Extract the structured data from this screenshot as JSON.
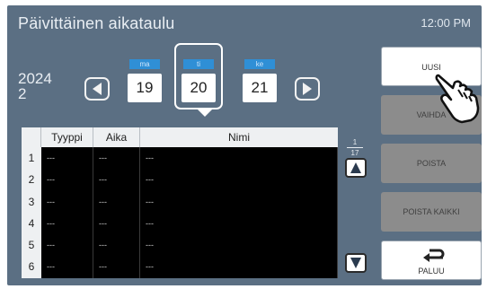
{
  "header": {
    "title": "Päivittäinen aikataulu",
    "time": "12:00 PM"
  },
  "date_nav": {
    "year": "2024",
    "month": "2",
    "days": [
      {
        "dow": "ma",
        "num": "19",
        "selected": false
      },
      {
        "dow": "ti",
        "num": "20",
        "selected": true
      },
      {
        "dow": "ke",
        "num": "21",
        "selected": false
      }
    ]
  },
  "table": {
    "headers": [
      "Tyyppi",
      "Aika",
      "Nimi"
    ],
    "row_numbers": [
      "1",
      "2",
      "3",
      "4",
      "5",
      "6"
    ],
    "rows": [
      [
        "---",
        "---",
        "---"
      ],
      [
        "---",
        "---",
        "---"
      ],
      [
        "---",
        "---",
        "---"
      ],
      [
        "---",
        "---",
        "---"
      ],
      [
        "---",
        "---",
        "---"
      ],
      [
        "---",
        "---",
        "---"
      ]
    ]
  },
  "pager": {
    "current": "1",
    "total": "17"
  },
  "actions": {
    "new": "UUSI",
    "change": "VAIHDA",
    "delete": "POISTA",
    "delete_all": "POISTA KAIKKI",
    "back": "PALUU"
  },
  "colors": {
    "background": "#5b6f83",
    "day_badge": "#2f8fd6",
    "disabled_button": "#8c8c8c",
    "table_body": "#000000"
  },
  "icons": {
    "prev": "chevron-left-icon",
    "next": "chevron-right-icon",
    "scroll_up": "triangle-up-icon",
    "scroll_down": "triangle-down-icon",
    "back": "return-arrow-icon",
    "pointer": "pointing-hand-icon"
  }
}
